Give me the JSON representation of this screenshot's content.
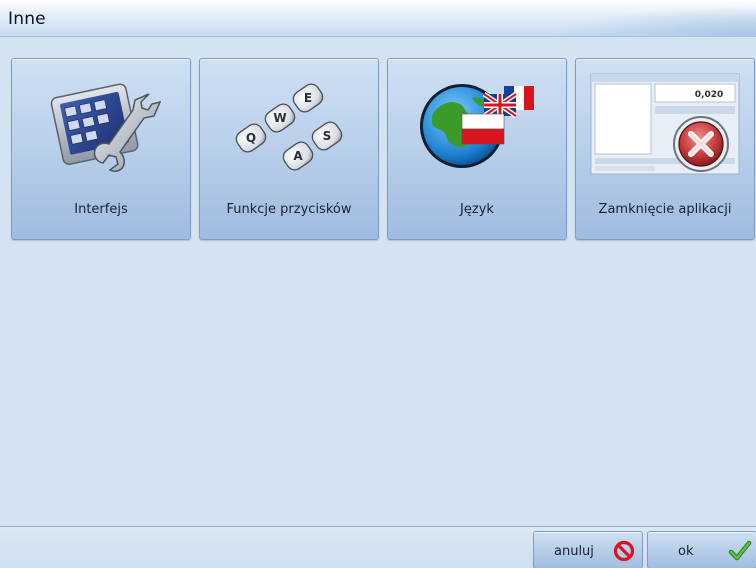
{
  "window": {
    "title": "Inne"
  },
  "tiles": [
    {
      "label": "Interfejs",
      "icon": "interface-settings-icon"
    },
    {
      "label": "Funkcje przycisków",
      "icon": "keyboard-keys-icon"
    },
    {
      "label": "Język",
      "icon": "language-globe-icon"
    },
    {
      "label": "Zamknięcie aplikacji",
      "icon": "close-application-icon"
    }
  ],
  "keys": {
    "q": "Q",
    "w": "W",
    "e": "E",
    "a": "A",
    "s": "S"
  },
  "mini_screen": {
    "value": "0,020"
  },
  "footer": {
    "cancel_label": "anuluj",
    "ok_label": "ok"
  },
  "colors": {
    "background": "#d4e3f2",
    "tile_top": "#cfe0f3",
    "tile_bottom": "#9fbbe0",
    "cancel_red": "#d9141e",
    "ok_green": "#3fa62a"
  }
}
